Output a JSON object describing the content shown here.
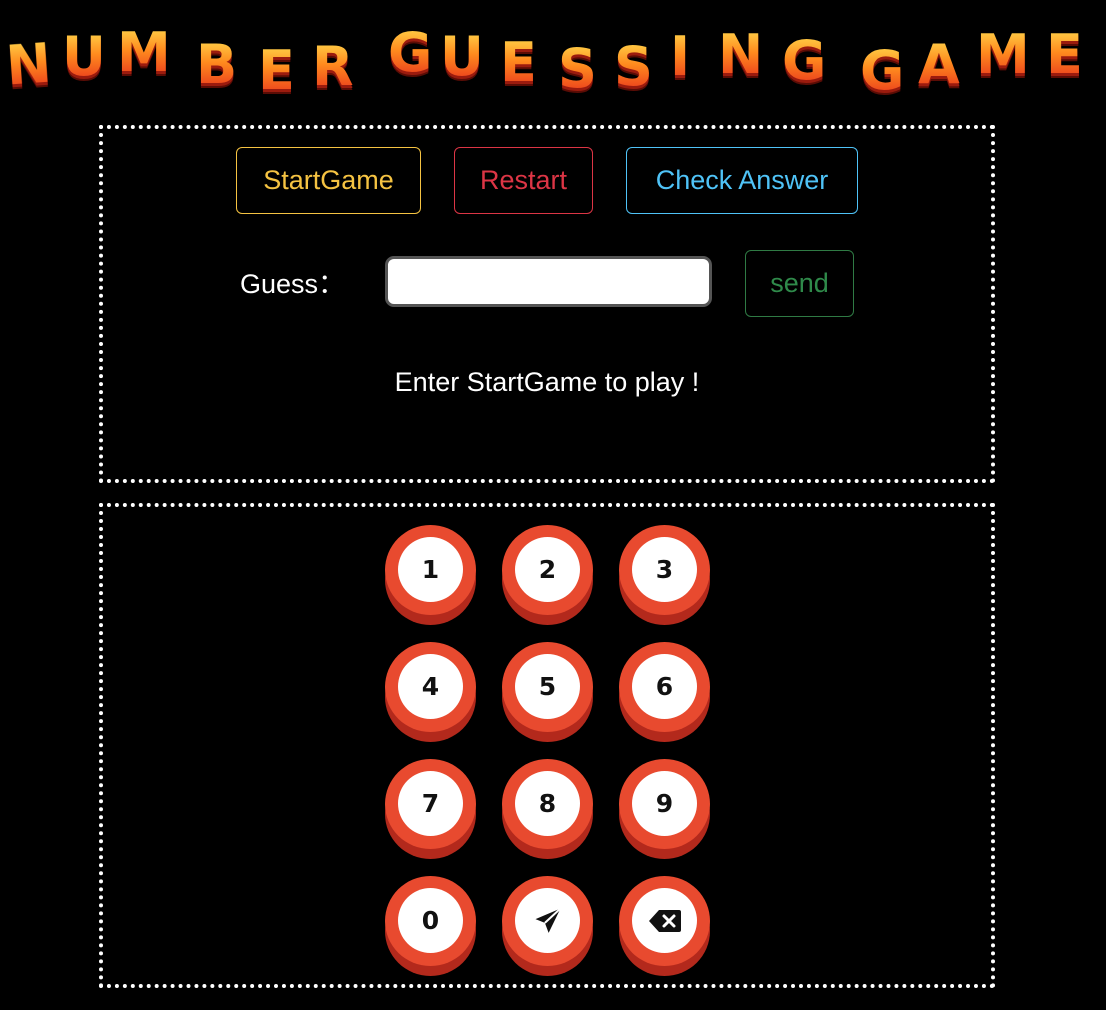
{
  "title": {
    "text": "NUMBER GUESSING GAME",
    "letters": [
      "N",
      "U",
      "M",
      "B",
      "E",
      "R",
      "G",
      "U",
      "E",
      "S",
      "S",
      "I",
      "N",
      "G",
      "G",
      "A",
      "M",
      "E"
    ]
  },
  "controls": {
    "start_label": "StartGame",
    "restart_label": "Restart",
    "check_label": "Check Answer"
  },
  "guess": {
    "label": "Guess：",
    "value": "",
    "placeholder": "",
    "send_label": "send"
  },
  "message": "Enter StartGame to play !",
  "keypad": {
    "keys": [
      "1",
      "2",
      "3",
      "4",
      "5",
      "6",
      "7",
      "8",
      "9",
      "0"
    ],
    "submit_icon": "paper-plane-icon",
    "delete_icon": "backspace-icon"
  },
  "colors": {
    "start": "#f5c342",
    "restart": "#dc3545",
    "check": "#4fc3f7",
    "send": "#2f8a4a",
    "key_ring": "#e84a2f"
  }
}
